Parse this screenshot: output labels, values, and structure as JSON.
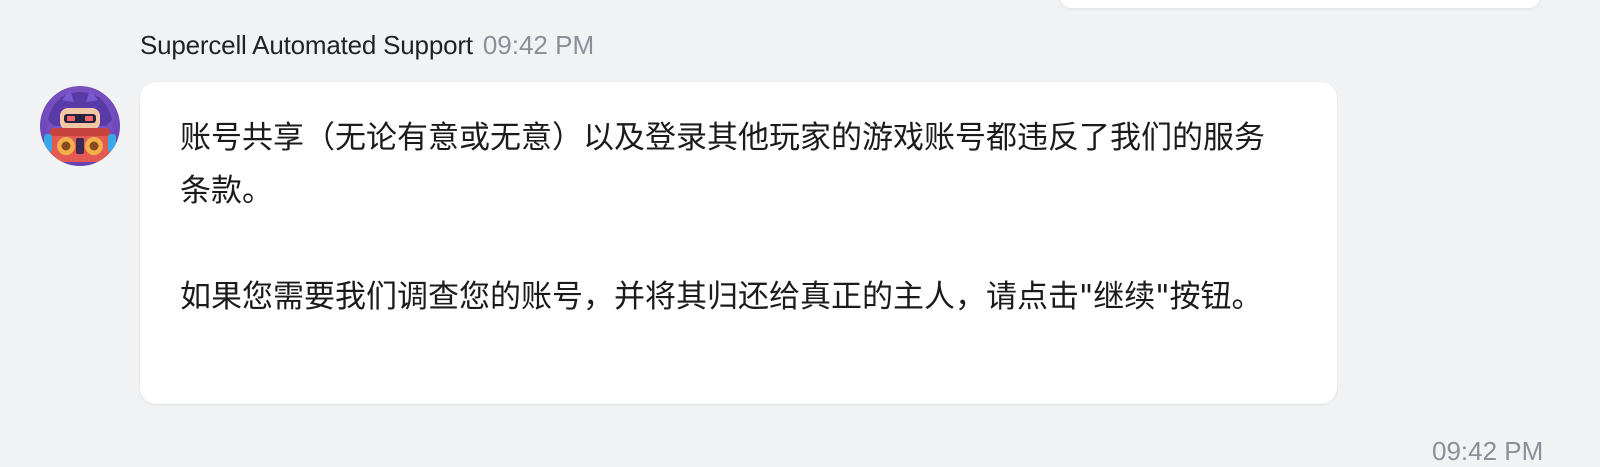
{
  "message": {
    "sender": "Supercell Automated Support",
    "time": "09:42 PM",
    "paragraphs": [
      "账号共享（无论有意或无意）以及登录其他玩家的游戏账号都违反了我们的服务条款。",
      "如果您需要我们调查您的账号，并将其归还给真正的主人，请点击\"继续\"按钮。"
    ]
  },
  "next_message": {
    "time": "09:42 PM"
  },
  "colors": {
    "background": "#f1f2f4",
    "bubble": "#ffffff",
    "text": "#1b1b1b",
    "muted": "#8a8f98"
  },
  "icons": {
    "avatar": "bot-avatar-icon"
  }
}
